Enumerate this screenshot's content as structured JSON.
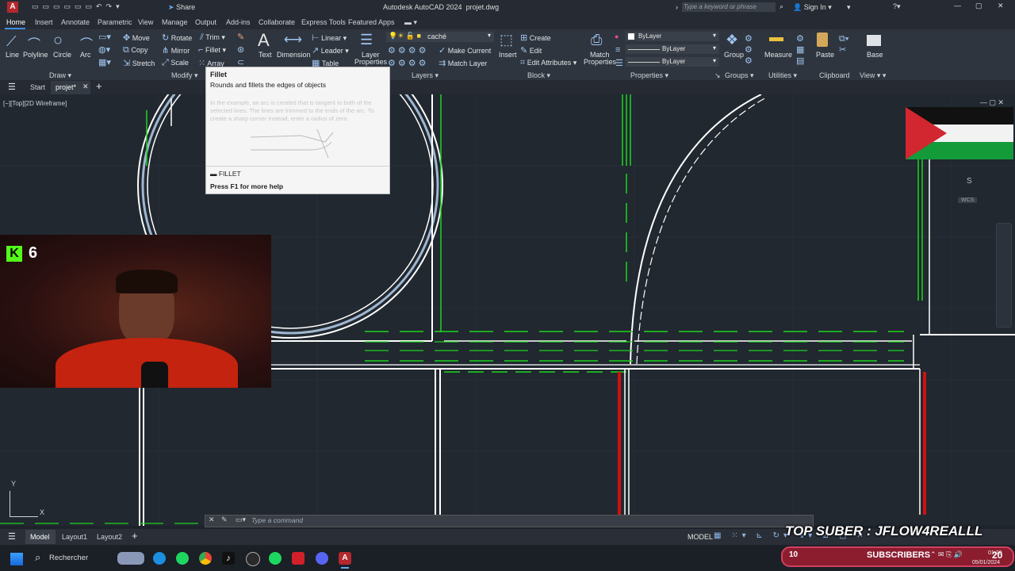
{
  "app": {
    "title": "Autodesk AutoCAD 2024",
    "filename": "projet.dwg",
    "share": "Share",
    "search_placeholder": "Type a keyword or phrase",
    "sign_in": "Sign In"
  },
  "ribbon_tabs": [
    "Home",
    "Insert",
    "Annotate",
    "Parametric",
    "View",
    "Manage",
    "Output",
    "Add-ins",
    "Collaborate",
    "Express Tools",
    "Featured Apps"
  ],
  "draw": {
    "line": "Line",
    "polyline": "Polyline",
    "circle": "Circle",
    "arc": "Arc",
    "panel": "Draw"
  },
  "modify": {
    "move": "Move",
    "rotate": "Rotate",
    "trim": "Trim",
    "copy": "Copy",
    "mirror": "Mirror",
    "fillet": "Fillet",
    "stretch": "Stretch",
    "scale": "Scale",
    "array": "Array",
    "panel": "Modify"
  },
  "annotation": {
    "text": "Text",
    "dimension": "Dimension",
    "linear": "Linear",
    "leader": "Leader",
    "table": "Table"
  },
  "layers": {
    "layer_properties_1": "Layer",
    "layer_properties_2": "Properties",
    "current_layer": "caché",
    "make_current": "Make Current",
    "match_layer": "Match Layer",
    "panel": "Layers"
  },
  "block": {
    "insert": "Insert",
    "create": "Create",
    "edit": "Edit",
    "edit_attributes": "Edit Attributes",
    "panel": "Block"
  },
  "properties": {
    "match_1": "Match",
    "match_2": "Properties",
    "bylayer_color": "ByLayer",
    "bylayer_line": "ByLayer",
    "bylayer_weight": "ByLayer",
    "panel": "Properties"
  },
  "groups": {
    "group": "Group",
    "panel": "Groups"
  },
  "utilities": {
    "measure": "Measure",
    "panel": "Utilities"
  },
  "clipboard": {
    "paste": "Paste",
    "panel": "Clipboard"
  },
  "view": {
    "base": "Base",
    "panel": "View"
  },
  "file_tabs": {
    "start": "Start",
    "projet": "projet*"
  },
  "viewport_label": "[−][Top][2D Wireframe]",
  "tooltip": {
    "title": "Fillet",
    "desc": "Rounds and fillets the edges of objects",
    "extended": "In the example, an arc is created that is tangent to both of the selected lines. The lines are trimmed to the ends of the arc. To create a sharp corner instead, enter a radius of zero.",
    "command": "FILLET",
    "help": "Press F1 for more help"
  },
  "viewcube": {
    "south": "S",
    "wcs": "WCS"
  },
  "ucs": {
    "y": "Y",
    "x": "X"
  },
  "command_placeholder": "Type a command",
  "layouts": [
    "Model",
    "Layout1",
    "Layout2"
  ],
  "status": {
    "model": "MODEL"
  },
  "overlay": {
    "counter": "6",
    "banner": "TOP SUBER : JFLOW4REALLL",
    "subs_count": "10",
    "subs_label": "SUBSCRIBERS",
    "sub_num": "20"
  },
  "taskbar": {
    "search": "Rechercher",
    "time": "01:20",
    "date": "05/01/2024"
  },
  "colors": {
    "accent": "#b3282d",
    "green_line": "#1ed51e",
    "red_line": "#d01010"
  }
}
